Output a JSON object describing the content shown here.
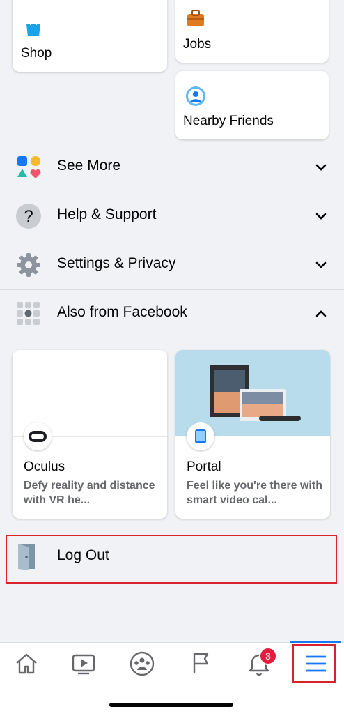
{
  "shortcuts": {
    "shop": "Shop",
    "jobs": "Jobs",
    "nearby_friends": "Nearby Friends"
  },
  "menu": {
    "see_more": "See More",
    "help_support": "Help & Support",
    "settings_privacy": "Settings & Privacy",
    "also_from_facebook": "Also from Facebook"
  },
  "products": [
    {
      "name": "Oculus",
      "description": "Defy reality and distance with VR he..."
    },
    {
      "name": "Portal",
      "description": "Feel like you're there with smart video cal..."
    }
  ],
  "logout": "Log Out",
  "bottom_nav": {
    "notifications_badge": "3"
  },
  "colors": {
    "accent": "#1877f2",
    "badge": "#e41e3f",
    "highlight_border": "#d8232a",
    "background": "#f0f2f5"
  }
}
